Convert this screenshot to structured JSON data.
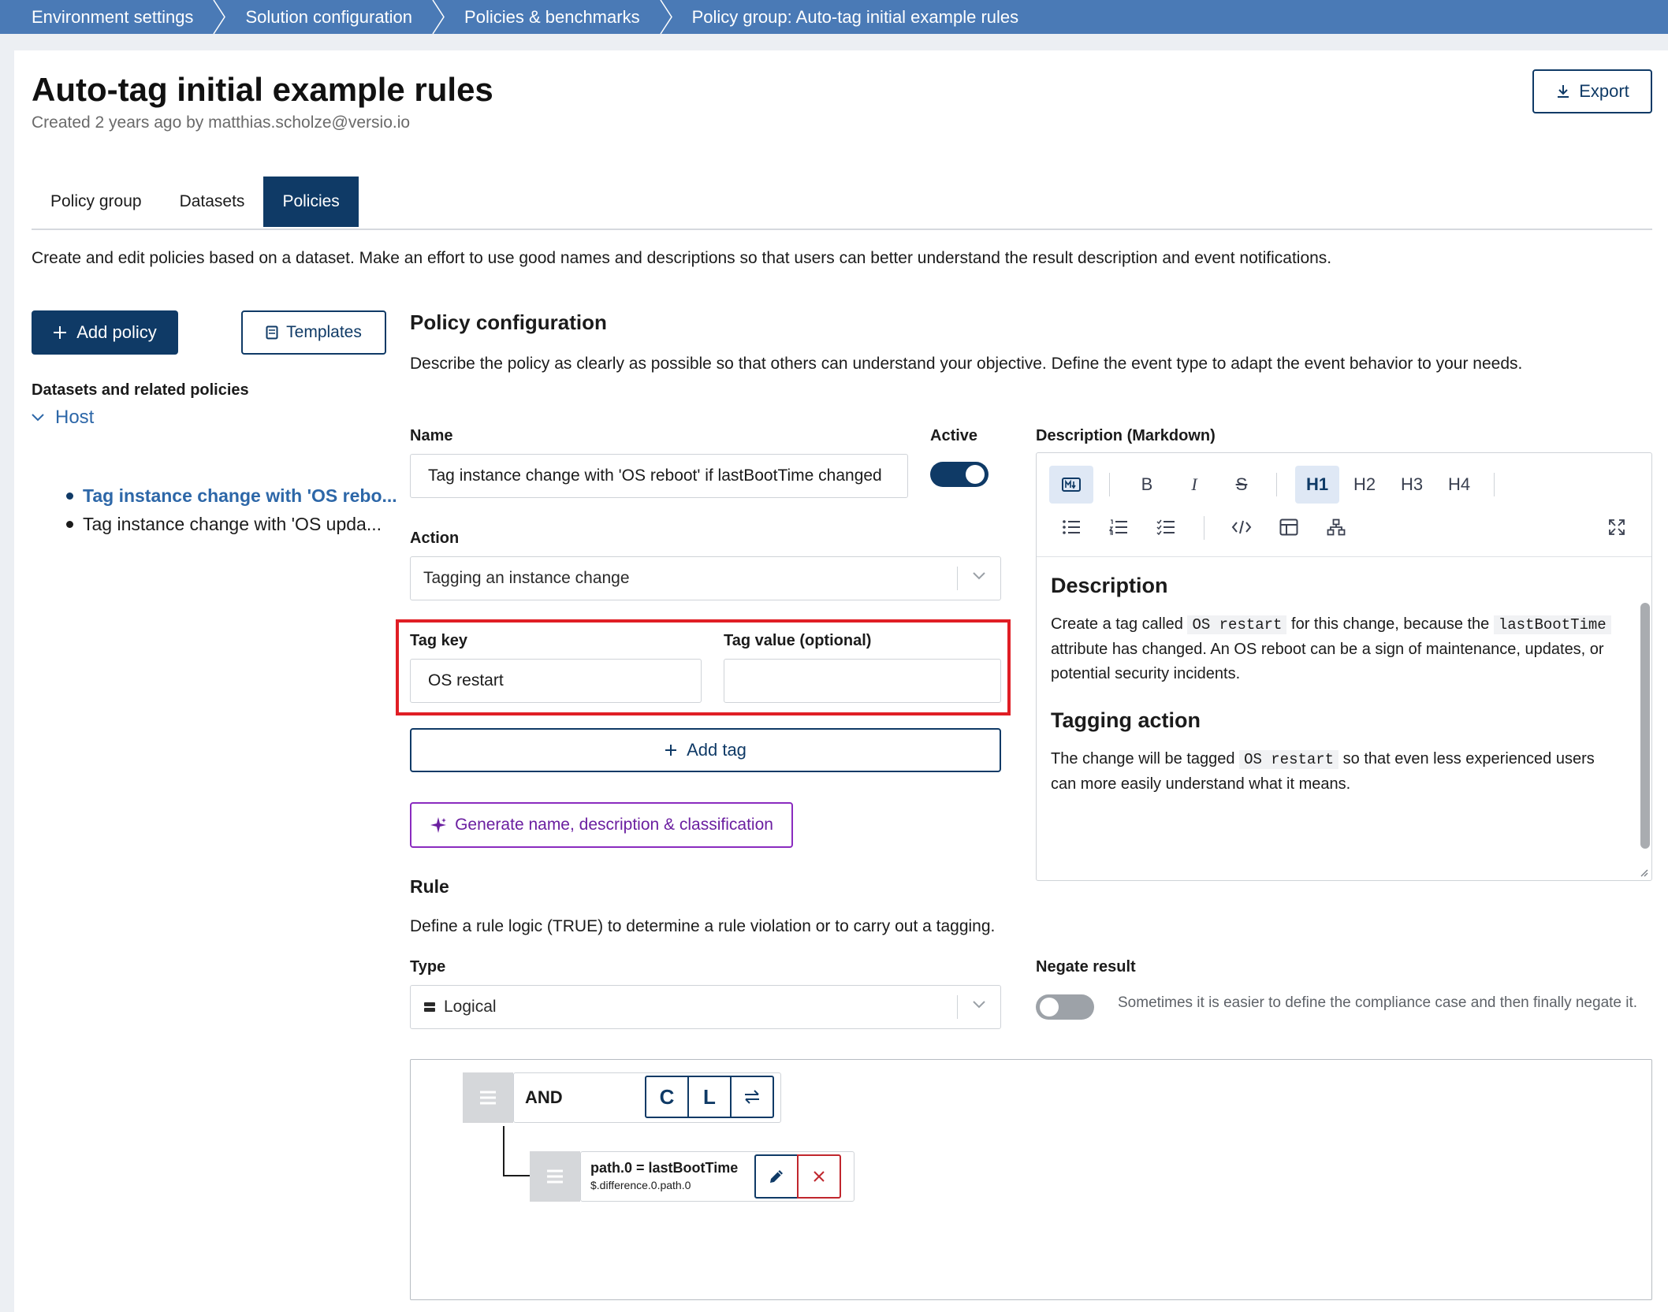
{
  "breadcrumb": [
    "Environment settings",
    "Solution configuration",
    "Policies & benchmarks",
    "Policy group: Auto-tag initial example rules"
  ],
  "header": {
    "title": "Auto-tag initial example rules",
    "created": "Created 2 years ago by matthias.scholze@versio.io",
    "export_label": "Export"
  },
  "tabs": [
    "Policy group",
    "Datasets",
    "Policies"
  ],
  "active_tab": "Policies",
  "intro": "Create and edit policies based on a dataset. Make an effort to use good names and descriptions so that users can better understand the result description and event notifications.",
  "sidebar": {
    "add_policy_label": "Add policy",
    "templates_label": "Templates",
    "tree_heading": "Datasets and related policies",
    "group": "Host",
    "items": [
      "Tag instance change with 'OS rebo...",
      "Tag instance change with 'OS upda..."
    ]
  },
  "config": {
    "title": "Policy configuration",
    "description": "Describe the policy as clearly as possible so that others can understand your objective. Define the event type to adapt the event behavior to your needs.",
    "name_label": "Name",
    "name_value": "Tag instance change with 'OS reboot' if lastBootTime changed",
    "active_label": "Active",
    "active": true,
    "action_label": "Action",
    "action_value": "Tagging an instance change",
    "tag_key_label": "Tag key",
    "tag_key_value": "OS restart",
    "tag_value_label": "Tag value (optional)",
    "tag_value_value": "",
    "add_tag_label": "Add tag",
    "generate_label": "Generate name, description & classification"
  },
  "markdown": {
    "label": "Description (Markdown)",
    "toolbar_row1": [
      "M↓",
      "B",
      "I",
      "S",
      "H1",
      "H2",
      "H3",
      "H4"
    ],
    "heading1": "Description",
    "p1_a": "Create a tag called ",
    "p1_code1": "OS restart",
    "p1_b": " for this change, because the ",
    "p1_code2": "lastBootTime",
    "p1_c": " attribute has changed. An OS reboot can be a sign of maintenance, updates, or potential security incidents.",
    "heading2": "Tagging action",
    "p2_a": "The change will be tagged ",
    "p2_code": "OS restart",
    "p2_b": " so that even less experienced users can more easily understand what it means."
  },
  "rule": {
    "title": "Rule",
    "description": "Define a rule logic (TRUE) to determine a rule violation or to carry out a tagging.",
    "type_label": "Type",
    "type_value": "Logical",
    "negate_label": "Negate result",
    "negate": false,
    "negate_hint": "Sometimes it is easier to define the compliance case and then finally negate it.",
    "operator": "AND",
    "btn_c": "C",
    "btn_l": "L",
    "condition_title": "path.0 = lastBootTime",
    "condition_path": "$.difference.0.path.0"
  },
  "colors": {
    "primary": "#0f3a66",
    "breadcrumb_bg": "#4a7ab6",
    "highlight": "#e01e25",
    "ai_purple": "#8a2bbf",
    "danger": "#c0262d"
  }
}
